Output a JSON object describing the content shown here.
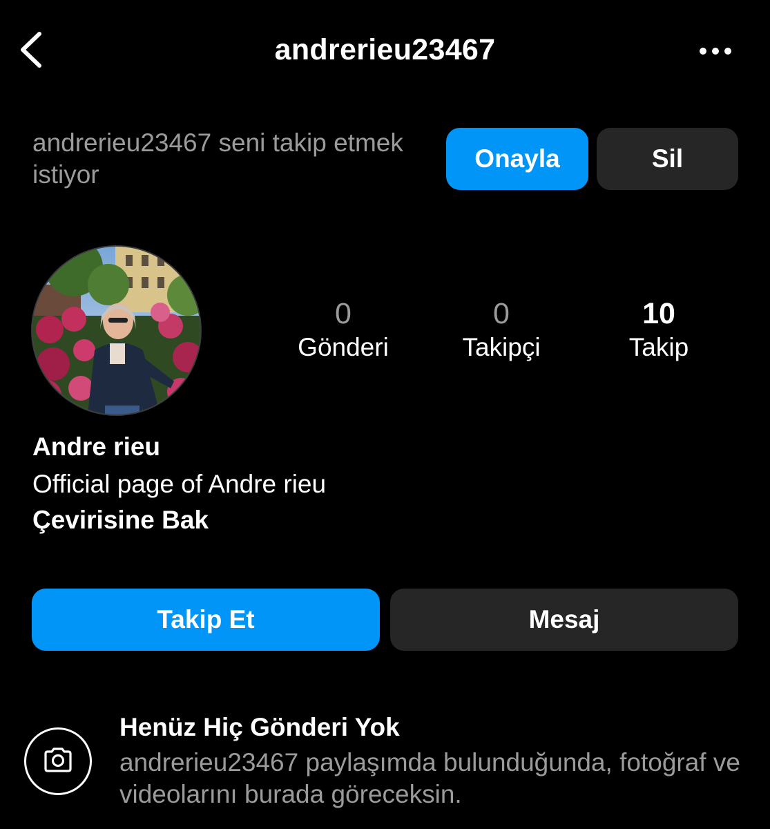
{
  "header": {
    "title": "andrerieu23467",
    "back_icon": "chevron-left-icon",
    "more_icon": "more-horizontal-icon"
  },
  "follow_request": {
    "text": "andrerieu23467 seni takip etmek istiyor",
    "approve_label": "Onayla",
    "delete_label": "Sil"
  },
  "profile": {
    "avatar_icon": "profile-photo",
    "stats": [
      {
        "value": "0",
        "label": "Gönderi"
      },
      {
        "value": "0",
        "label": "Takipçi"
      },
      {
        "value": "10",
        "label": "Takip"
      }
    ],
    "name": "Andre rieu",
    "bio": "Official page of Andre rieu",
    "translate_label": "Çevirisine Bak"
  },
  "actions": {
    "follow_label": "Takip Et",
    "message_label": "Mesaj"
  },
  "empty_state": {
    "icon": "camera-icon",
    "title": "Henüz Hiç Gönderi Yok",
    "description": "andrerieu23467 paylaşımda bulunduğunda, fotoğraf ve videolarını burada göreceksin."
  },
  "colors": {
    "background": "#000000",
    "accent_blue": "#0095f6",
    "button_gray": "#262626",
    "secondary_text": "#9b9b9b"
  }
}
